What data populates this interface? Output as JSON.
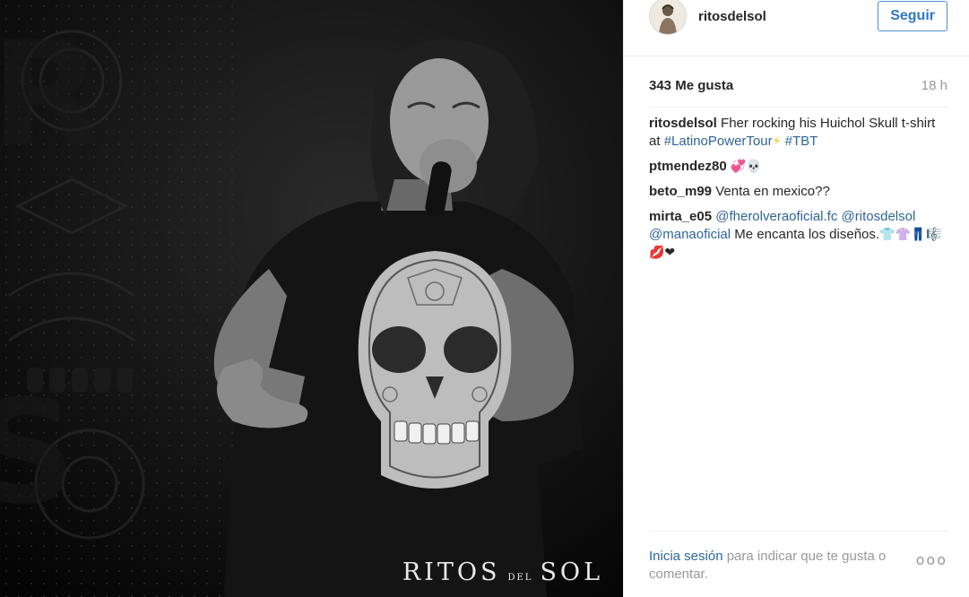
{
  "header": {
    "username": "ritosdelsol",
    "follow_label": "Seguir"
  },
  "stats": {
    "likes": "343 Me gusta",
    "time": "18 h"
  },
  "photo": {
    "watermark_main_1": "RITOS",
    "watermark_small": "DEL",
    "watermark_main_2": "SOL"
  },
  "comments": {
    "c1_user": "ritosdelsol",
    "c1_text": "Fher rocking his Huichol Skull t-shirt at",
    "c1_tag1": "#LatinoPowerTour",
    "c1_emoji": "⚡",
    "c1_tag2": "#TBT",
    "c2_user": "ptmendez80",
    "c2_emoji": "💞💀",
    "c3_user": "beto_m99",
    "c3_text": "Venta en mexico??",
    "c4_user": "mirta_e05",
    "c4_mention1": "@fherolveraoficial.fc",
    "c4_mention2": "@ritosdelsol",
    "c4_mention3": "@manaoficial",
    "c4_text": "Me encanta los diseños.",
    "c4_emoji": "👕👚👖🎼💋❤"
  },
  "footer": {
    "login_link": "Inicia sesión",
    "login_text": "para indicar que te gusta o comentar.",
    "more": "ooo"
  },
  "colors": {
    "link": "#2d6599",
    "follow_border": "#4d8fd1",
    "muted": "#999999",
    "text": "#262626"
  }
}
